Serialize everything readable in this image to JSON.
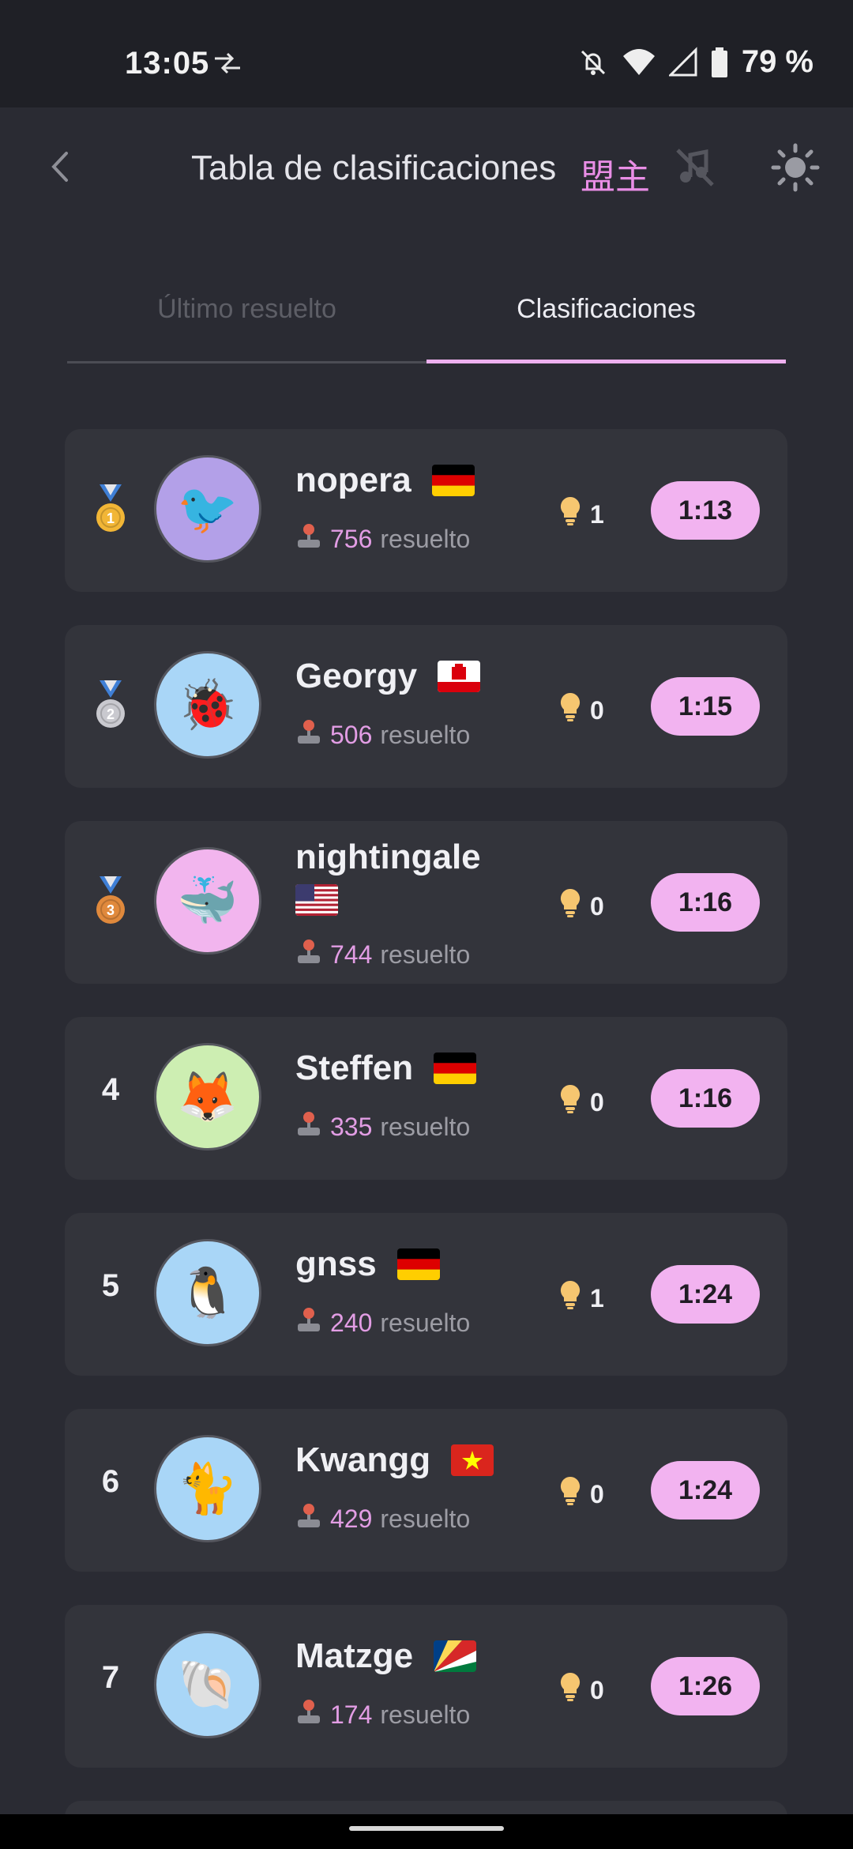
{
  "status_bar": {
    "time": "13:05",
    "battery": "79 %"
  },
  "header": {
    "title": "Tabla de clasificaciones",
    "badge": "盟主"
  },
  "tabs": [
    {
      "label": "Último resuelto",
      "active": false
    },
    {
      "label": "Clasificaciones",
      "active": true
    }
  ],
  "players": [
    {
      "rank": "1",
      "medal": "gold",
      "name": "nopera",
      "flag": "de",
      "avatar": "🐦",
      "avatar_bg": "#b3a0e8",
      "solved": "756",
      "solved_label": "resuelto",
      "hints": "1",
      "time": "1:13"
    },
    {
      "rank": "2",
      "medal": "silver",
      "name": "Georgy",
      "flag": "gi",
      "avatar": "🐞",
      "avatar_bg": "#a9d6f7",
      "solved": "506",
      "solved_label": "resuelto",
      "hints": "0",
      "time": "1:15"
    },
    {
      "rank": "3",
      "medal": "bronze",
      "name": "nightingale",
      "flag": "us",
      "avatar": "🐳",
      "avatar_bg": "#f2b5ee",
      "solved": "744",
      "solved_label": "resuelto",
      "hints": "0",
      "time": "1:16"
    },
    {
      "rank": "4",
      "medal": "",
      "name": "Steffen",
      "flag": "de",
      "avatar": "🦊",
      "avatar_bg": "#cdeeb2",
      "solved": "335",
      "solved_label": "resuelto",
      "hints": "0",
      "time": "1:16"
    },
    {
      "rank": "5",
      "medal": "",
      "name": "gnss",
      "flag": "de",
      "avatar": "🐧",
      "avatar_bg": "#a9d6f7",
      "solved": "240",
      "solved_label": "resuelto",
      "hints": "1",
      "time": "1:24"
    },
    {
      "rank": "6",
      "medal": "",
      "name": "Kwangg",
      "flag": "vn",
      "avatar": "🐈",
      "avatar_bg": "#a9d6f7",
      "solved": "429",
      "solved_label": "resuelto",
      "hints": "0",
      "time": "1:24"
    },
    {
      "rank": "7",
      "medal": "",
      "name": "Matzge",
      "flag": "sc",
      "avatar": "🐚",
      "avatar_bg": "#a9d6f7",
      "solved": "174",
      "solved_label": "resuelto",
      "hints": "0",
      "time": "1:26"
    }
  ],
  "colors": {
    "accent": "#eeb0ef",
    "pill": "#f2b3f0",
    "card": "#33343b",
    "background": "#2a2b33"
  },
  "icons": [
    "back-arrow-icon",
    "music-off-icon",
    "sun-icon",
    "medal-gold-icon",
    "medal-silver-icon",
    "medal-bronze-icon",
    "joystick-icon",
    "lightbulb-icon"
  ]
}
